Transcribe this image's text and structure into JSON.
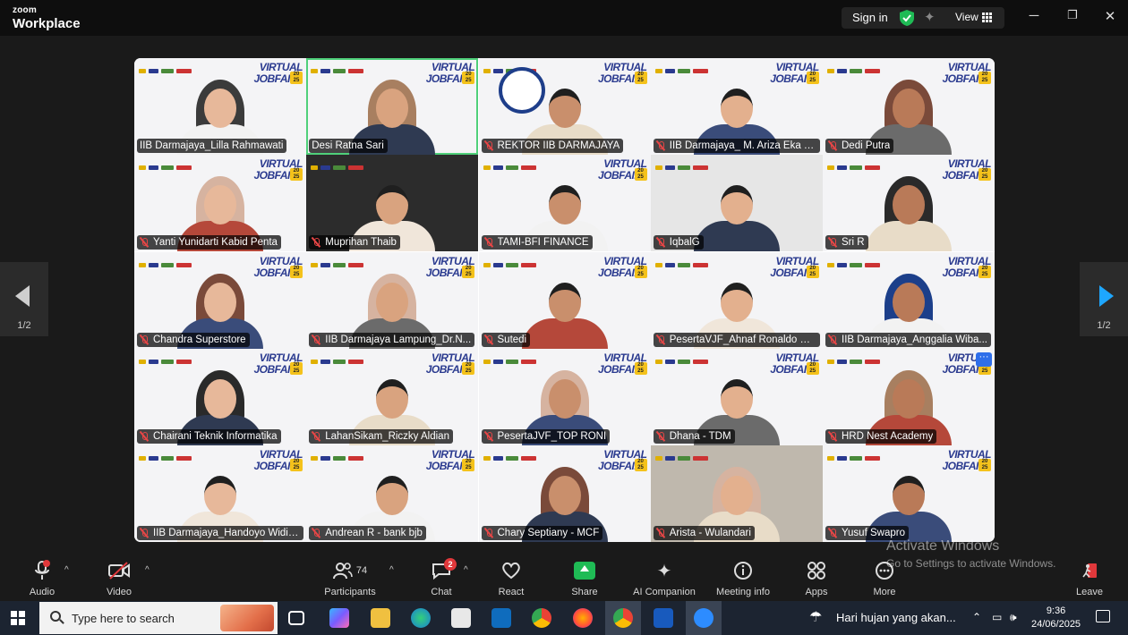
{
  "app": {
    "brand_small": "zoom",
    "brand_large": "Workplace"
  },
  "titlebar": {
    "sign_in": "Sign in",
    "view": "View",
    "icons": [
      "shield-check-icon",
      "sparkle-icon",
      "grid-view-icon",
      "minimize-icon",
      "restore-icon",
      "close-icon"
    ]
  },
  "nav": {
    "page_left": "1/2",
    "page_right": "1/2"
  },
  "participants": [
    {
      "name": "IIB Darmajaya_Lilla Rahmawati",
      "muted": false
    },
    {
      "name": "Desi Ratna Sari",
      "muted": false,
      "active_speaker": true
    },
    {
      "name": "REKTOR IIB DARMAJAYA",
      "muted": true
    },
    {
      "name": "IIB Darmajaya_ M. Ariza Eka Y...",
      "muted": true
    },
    {
      "name": "Dedi Putra",
      "muted": true
    },
    {
      "name": "Yanti Yunidarti Kabid Penta",
      "muted": true
    },
    {
      "name": "Muprihan Thaib",
      "muted": true
    },
    {
      "name": "TAMI-BFI FINANCE",
      "muted": true
    },
    {
      "name": "IqbalG",
      "muted": true
    },
    {
      "name": "Sri R",
      "muted": true
    },
    {
      "name": "Chandra Superstore",
      "muted": true
    },
    {
      "name": "IIB Darmajaya Lampung_Dr.N...",
      "muted": true
    },
    {
      "name": "Sutedi",
      "muted": true
    },
    {
      "name": "PesertaVJF_Ahnaf Ronaldo Na...",
      "muted": true
    },
    {
      "name": "IIB Darmajaya_Anggalia Wiba...",
      "muted": true
    },
    {
      "name": "Chairani Teknik Informatika",
      "muted": true
    },
    {
      "name": "LahanSikam_Riczky Aldian",
      "muted": true
    },
    {
      "name": "PesertaJVF_TOP RONI",
      "muted": true
    },
    {
      "name": "Dhana - TDM",
      "muted": true
    },
    {
      "name": "HRD Nest Academy",
      "muted": true
    },
    {
      "name": "IIB Darmajaya_Handoyo Widi N...",
      "muted": true
    },
    {
      "name": "Andrean R - bank bjb",
      "muted": true
    },
    {
      "name": "Chary Septiany - MCF",
      "muted": true
    },
    {
      "name": "Arista - Wulandari",
      "muted": true
    },
    {
      "name": "Yusuf Swapro",
      "muted": true
    }
  ],
  "tile_banner": {
    "line1": "VIRTUAL",
    "line2": "JOBFAIR",
    "year": "20 25"
  },
  "toolbar": {
    "audio": "Audio",
    "video": "Video",
    "participants": "Participants",
    "participants_count": "74",
    "chat": "Chat",
    "chat_badge": "2",
    "react": "React",
    "share": "Share",
    "ai_companion": "AI Companion",
    "meeting_info": "Meeting info",
    "apps": "Apps",
    "more": "More",
    "leave": "Leave"
  },
  "watermark": {
    "line1": "Activate Windows",
    "line2": "Go to Settings to activate Windows."
  },
  "taskbar": {
    "search_placeholder": "Type here to search",
    "weather": "Hari hujan yang akan...",
    "time": "9:36",
    "date": "24/06/2025"
  },
  "colors": {
    "active_speaker": "#4fd07a",
    "muted": "#e84646",
    "accent": "#1ea7ff",
    "share": "#1fbb55"
  }
}
